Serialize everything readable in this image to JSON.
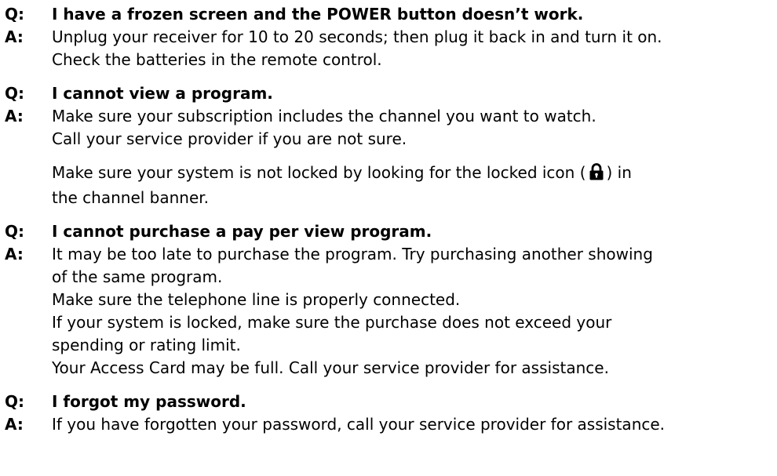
{
  "labels": {
    "q": "Q:",
    "a": "A:"
  },
  "items": [
    {
      "question": "I have a frozen screen and the POWER button doesn’t work.",
      "answer_lines": [
        "Unplug your receiver for 10 to 20 seconds; then plug it back in and turn it on.",
        "Check the batteries in the remote control."
      ]
    },
    {
      "question": "I cannot view a program.",
      "answer_lines": [
        "Make sure your subscription includes the channel you want to watch.",
        "Call your service provider if you are not sure."
      ],
      "extra_paragraph": {
        "before_icon": "Make sure your system is not locked by looking for the locked icon (",
        "icon": "lock-icon",
        "after_icon": ") in",
        "line2": "the channel banner."
      }
    },
    {
      "question": "I cannot purchase a pay per view program.",
      "answer_lines": [
        "It may be too late to purchase the program. Try purchasing another showing",
        "of the same program.",
        "Make sure the telephone line is properly connected.",
        "If your system is locked, make sure the purchase does not exceed your",
        "spending or rating limit.",
        "Your Access Card may be full. Call your service provider for assistance."
      ]
    },
    {
      "question": "I forgot my password.",
      "answer_lines": [
        "If you have forgotten your password, call your service provider for assistance."
      ]
    }
  ]
}
